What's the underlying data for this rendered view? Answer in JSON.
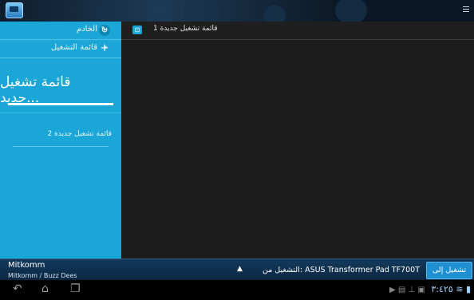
{
  "sidebar": {
    "server_label": "الخادم",
    "playlist_label": "قائمة التشغيل",
    "refresh_icon": "↻",
    "add_icon": "+",
    "new_playlist_title": "قائمة تشغيل جديد...",
    "items": [
      {
        "label": "قائمة تشغيل جديدة 2"
      }
    ]
  },
  "main": {
    "playlist_icon": "⊡",
    "title": "قائمة تشغيل جديدة 1"
  },
  "player": {
    "artist": "Mitkomm",
    "subline": "Mitkomm / Buzz Dees",
    "expand_icon": "▲",
    "playing_from": "التشغيل من: ASUS Transformer Pad TF700T",
    "play_to_label": "تشغيل إلى"
  },
  "nav": {
    "back_icon": "↶",
    "home_icon": "⌂",
    "recents_icon": "❐",
    "status_icons": "▶ ▤ ⊥ ▣",
    "clock": "٣:٤٢٥"
  },
  "colors": {
    "accent": "#1aa6d6",
    "player_bar": "#143a5c",
    "play_to_button": "#1e8fd0"
  }
}
